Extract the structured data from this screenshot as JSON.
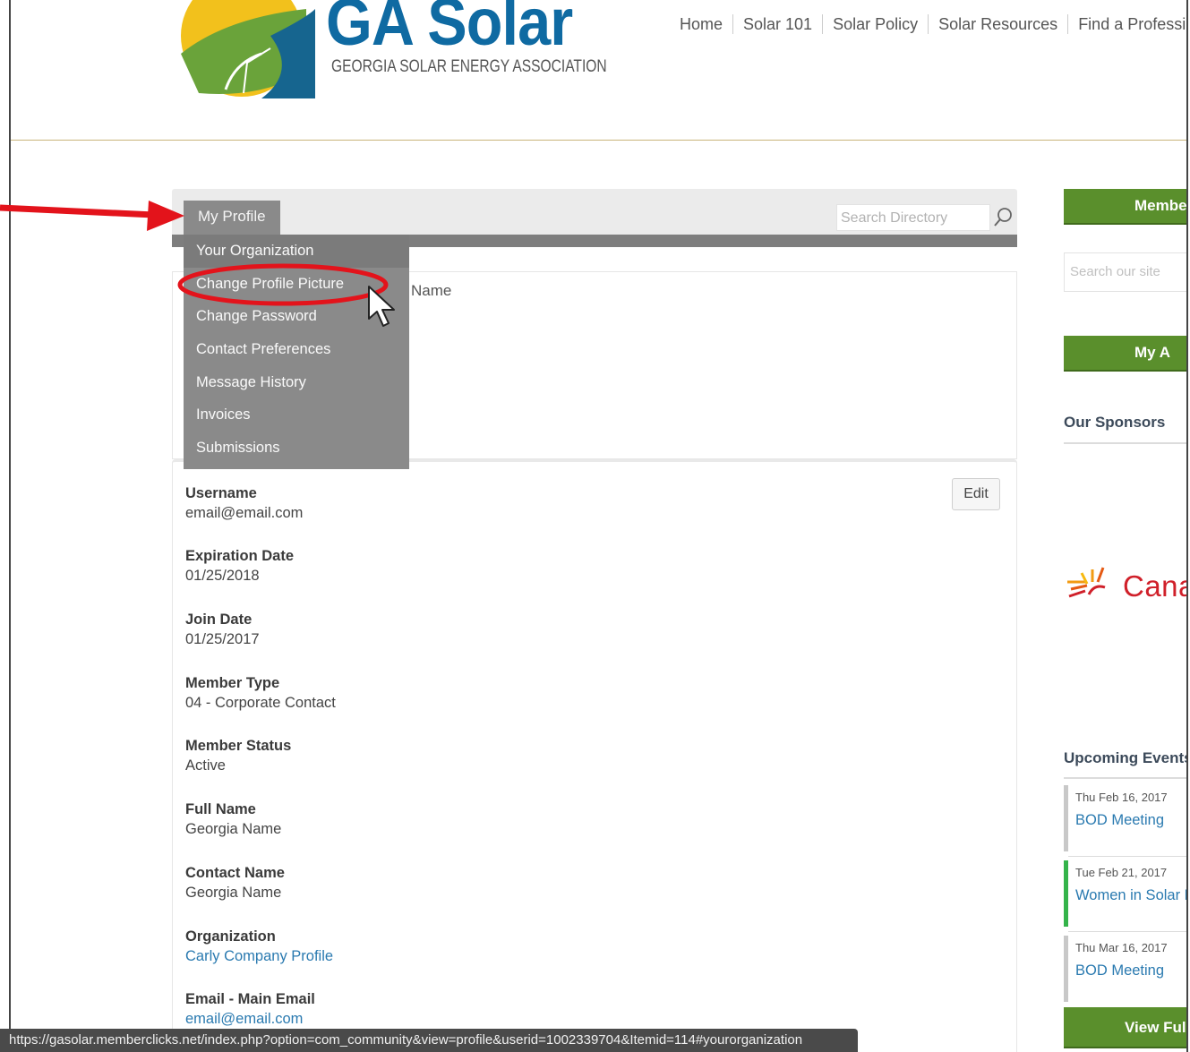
{
  "header": {
    "brand_name": "GA Solar",
    "brand_tagline": "GEORGIA SOLAR ENERGY ASSOCIATION",
    "nav": [
      "Home",
      "Solar 101",
      "Solar Policy",
      "Solar Resources",
      "Find a Professi"
    ]
  },
  "tabs": {
    "my_profile": "My Profile",
    "search_placeholder": "Search Directory"
  },
  "dropdown": {
    "items": [
      "Your Organization",
      "Change Profile Picture",
      "Change Password",
      "Contact Preferences",
      "Message History",
      "Invoices",
      "Submissions"
    ]
  },
  "profile": {
    "name_label": "Name",
    "edit_label": "Edit",
    "fields": [
      {
        "label": "Username",
        "value": "email@email.com"
      },
      {
        "label": "Expiration Date",
        "value": "01/25/2018"
      },
      {
        "label": "Join Date",
        "value": "01/25/2017"
      },
      {
        "label": "Member Type",
        "value": "04 - Corporate Contact"
      },
      {
        "label": "Member Status",
        "value": "Active"
      },
      {
        "label": "Full Name",
        "value": "Georgia Name"
      },
      {
        "label": "Contact Name",
        "value": "Georgia Name"
      },
      {
        "label": "Organization",
        "value": "Carly Company Profile"
      },
      {
        "label": "Email - Main Email",
        "value": "email@email.com"
      }
    ]
  },
  "sidebar": {
    "member_button": "Membe",
    "site_search_placeholder": "Search our site",
    "my_account_button": "My A",
    "sponsors_heading": "Our Sponsors",
    "sponsor_text": "Cana",
    "events_heading": "Upcoming Events",
    "events": [
      {
        "date": "Thu Feb 16, 2017",
        "title": "BOD Meeting"
      },
      {
        "date": "Tue Feb 21, 2017",
        "title": "Women in Solar E"
      },
      {
        "date": "Thu Mar 16, 2017",
        "title": "BOD Meeting"
      }
    ],
    "view_full_button": "View Full"
  },
  "status_bar": {
    "url": "https://gasolar.memberclicks.net/index.php?option=com_community&view=profile&userid=1002339704&Itemid=114#yourorganization"
  },
  "colors": {
    "brand_blue": "#0f6aa2",
    "sidebar_green": "#5a8f2c",
    "annotation_red": "#e3131b",
    "link_blue": "#2a7ab0"
  }
}
